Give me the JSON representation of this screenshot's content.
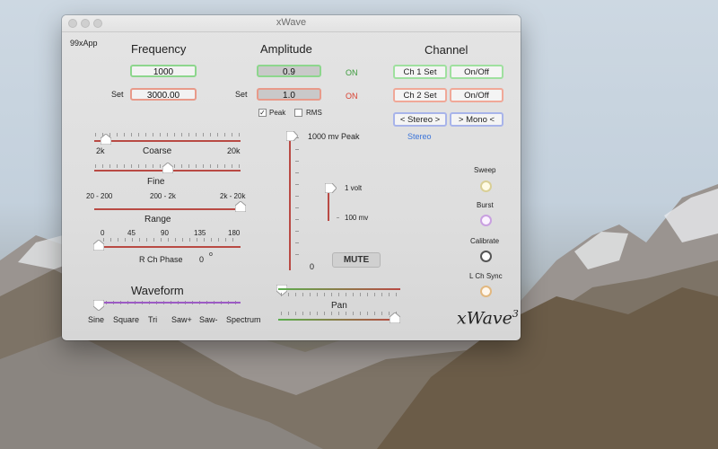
{
  "window": {
    "title": "xWave"
  },
  "brand": {
    "tag": "99xApp",
    "logo": "xWave",
    "logo_sup": "3"
  },
  "frequency": {
    "heading": "Frequency",
    "value": "1000",
    "set_label": "Set",
    "set_value": "3000.00",
    "coarse_min": "2k",
    "coarse_max": "20k",
    "coarse_label": "Coarse",
    "coarse_level": 0.08,
    "fine_label": "Fine",
    "fine_level": 0.5,
    "range_label": "Range",
    "range_options": [
      "20 - 200",
      "200 - 2k",
      "2k - 20k"
    ],
    "range_level": 1.0,
    "phase_ticks": [
      "0",
      "45",
      "90",
      "135",
      "180"
    ],
    "phase_label": "R Ch Phase",
    "phase_value": "0",
    "phase_unit": "o"
  },
  "amplitude": {
    "heading": "Amplitude",
    "value": "0.9",
    "on1": "ON",
    "set_label": "Set",
    "set_value": "1.0",
    "on2": "ON",
    "peak_label": "Peak",
    "peak_checked": true,
    "rms_label": "RMS",
    "rms_checked": false,
    "top_label": "1000 mv  Peak",
    "bottom_label": "0",
    "volt_label": "1 volt",
    "mv_label": "100 mv",
    "mute_label": "MUTE"
  },
  "channel": {
    "heading": "Channel",
    "ch1_label": "Ch 1 Set",
    "ch1_toggle": "On/Off",
    "ch2_label": "Ch 2 Set",
    "ch2_toggle": "On/Off",
    "stereo_button": "< Stereo >",
    "mono_button": "> Mono <",
    "mode_status": "Stereo",
    "sweep_label": "Sweep",
    "burst_label": "Burst",
    "calibrate_label": "Calibrate",
    "lsync_label": "L Ch Sync"
  },
  "waveform": {
    "heading": "Waveform",
    "options": [
      "Sine",
      "Square",
      "Tri",
      "Saw+",
      "Saw-",
      "Spectrum"
    ],
    "selected_level": 0.0
  },
  "pan": {
    "label": "Pan"
  },
  "colors": {
    "green": "#8dd68d",
    "red": "#e89a8a",
    "blue": "#a8b4ea",
    "track": "#b94a44",
    "purple": "#9c5cc4",
    "on_green": "#3a9a3a",
    "on_red": "#d94030"
  }
}
